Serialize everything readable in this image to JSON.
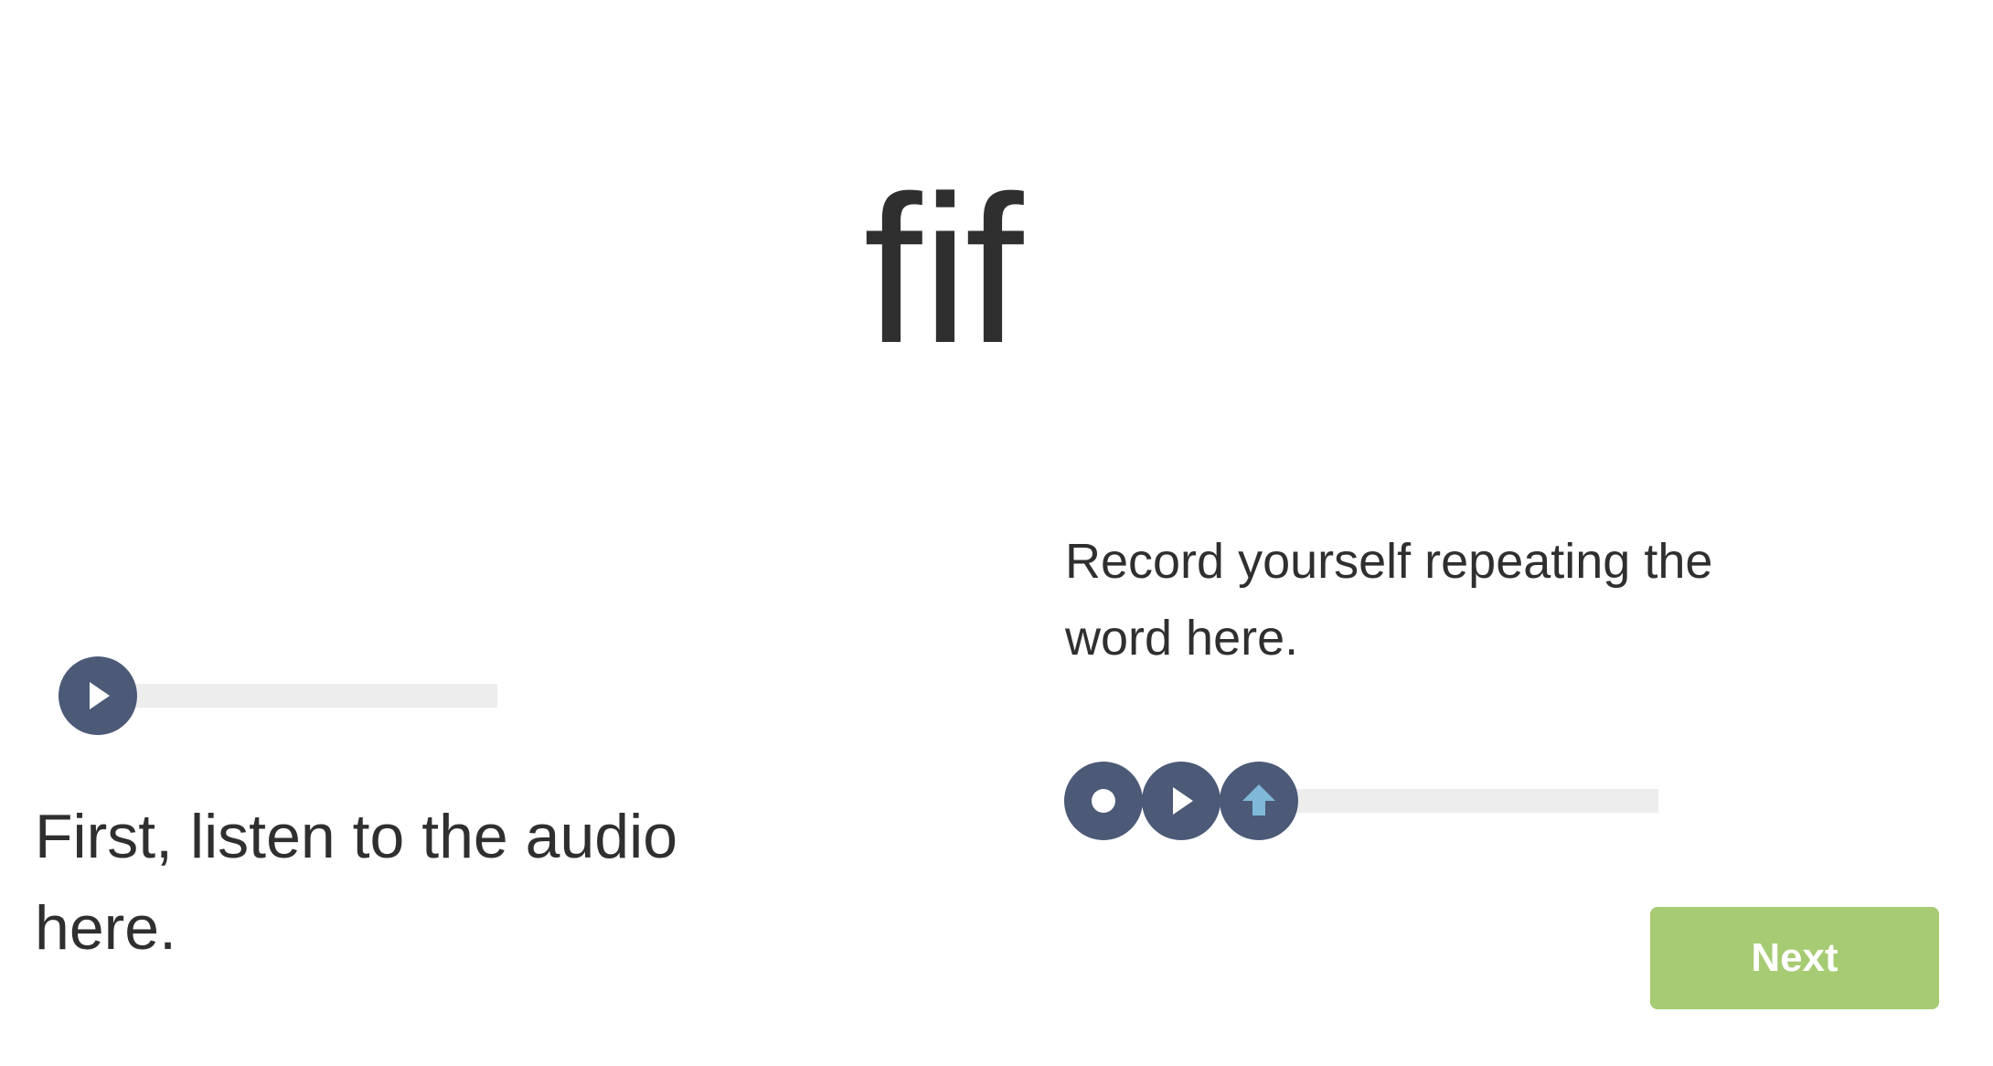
{
  "word": "ﬁf",
  "listen": {
    "caption": "First, listen to the audio here.",
    "play_icon": "play-icon",
    "progress": 0
  },
  "record": {
    "caption": "Record yourself repeating the word here.",
    "record_icon": "record-icon",
    "play_icon": "play-icon",
    "upload_icon": "upload-arrow-icon",
    "progress": 0
  },
  "next_label": "Next",
  "colors": {
    "button_dark": "#4c5977",
    "track": "#ededee",
    "next_green": "#a6cb72",
    "upload_arrow": "#7fb8d8",
    "text": "#2f2f2f"
  }
}
